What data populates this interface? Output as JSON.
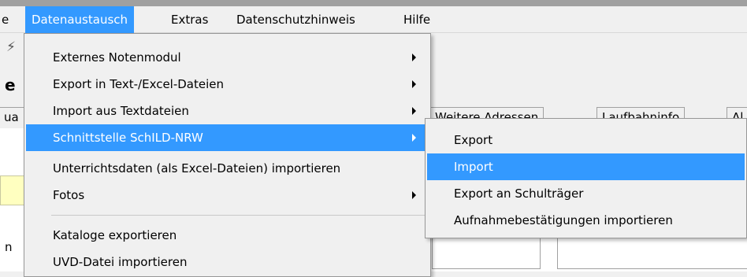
{
  "menubar": {
    "items": [
      {
        "label": "e"
      },
      {
        "label": "Datenaustausch"
      },
      {
        "label": "Extras"
      },
      {
        "label": "Datenschutzhinweis"
      },
      {
        "label": "Hilfe"
      }
    ]
  },
  "background": {
    "bold_letter": "e",
    "tabs": [
      "ua",
      "Weitere Adressen",
      "Laufbahninfo",
      "Al"
    ],
    "row_letter": "n"
  },
  "datenaustausch_menu": {
    "items": [
      {
        "label": "Externes Notenmodul",
        "submenu": true
      },
      {
        "label": "Export in Text-/Excel-Dateien",
        "submenu": true
      },
      {
        "label": "Import aus Textdateien",
        "submenu": true
      },
      {
        "label": "Schnittstelle SchILD-NRW",
        "submenu": true,
        "highlighted": true
      },
      {
        "label": "Unterrichtsdaten (als Excel-Dateien) importieren",
        "submenu": false
      },
      {
        "label": "Fotos",
        "submenu": true
      },
      {
        "label": "Kataloge exportieren",
        "submenu": false
      },
      {
        "label": "UVD-Datei importieren",
        "submenu": false
      }
    ]
  },
  "schild_submenu": {
    "items": [
      {
        "label": "Export"
      },
      {
        "label": "Import",
        "highlighted": true
      },
      {
        "label": "Export an Schulträger"
      },
      {
        "label": "Aufnahmebestätigungen importieren"
      }
    ]
  },
  "colors": {
    "highlight": "#3399ff",
    "menu_bg": "#f0f0f0",
    "menu_border": "#979797",
    "yellow_field": "#ffffc0"
  }
}
